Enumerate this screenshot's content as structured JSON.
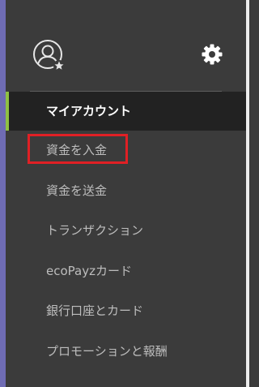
{
  "header": {
    "avatar_icon": "user-star-icon",
    "settings_icon": "gear-icon"
  },
  "menu": {
    "items": [
      {
        "label": "マイアカウント",
        "active": true
      },
      {
        "label": "資金を入金",
        "highlighted": true
      },
      {
        "label": "資金を送金"
      },
      {
        "label": "トランザクション"
      },
      {
        "label": "ecoPayzカード"
      },
      {
        "label": "銀行口座とカード"
      },
      {
        "label": "プロモーションと報酬"
      }
    ]
  },
  "colors": {
    "background": "#3b3b3b",
    "active_background": "#222222",
    "active_indicator": "#8fc043",
    "left_strip": "#6f6cb4",
    "highlight_box": "#e02025",
    "text": "#bdbdbd",
    "active_text": "#ffffff"
  }
}
